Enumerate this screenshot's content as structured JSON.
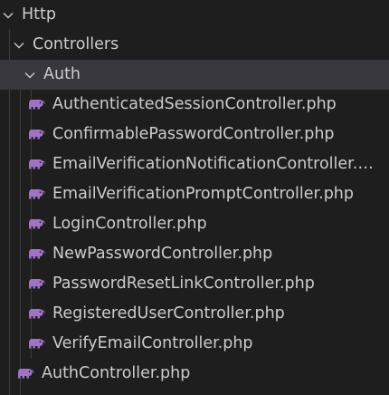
{
  "explorer": {
    "tree": {
      "folder_http": "Http",
      "folder_controllers": "Controllers",
      "folder_auth": "Auth",
      "auth_files": [
        "AuthenticatedSessionController.php",
        "ConfirmablePasswordController.php",
        "EmailVerificationNotificationController.php",
        "EmailVerificationPromptController.php",
        "LoginController.php",
        "NewPasswordController.php",
        "PasswordResetLinkController.php",
        "RegisteredUserController.php",
        "VerifyEmailController.php"
      ],
      "controllers_files": [
        "AuthController.php"
      ]
    },
    "icons": {
      "folder_expanded": "chevron-down-icon",
      "php_file": "php-elephant-icon"
    },
    "colors": {
      "background": "#1e1e1e",
      "selected_row": "#37373d",
      "text": "#cccccc",
      "php_icon": "#a074c4",
      "indent_guide": "#3c3c3c"
    }
  }
}
